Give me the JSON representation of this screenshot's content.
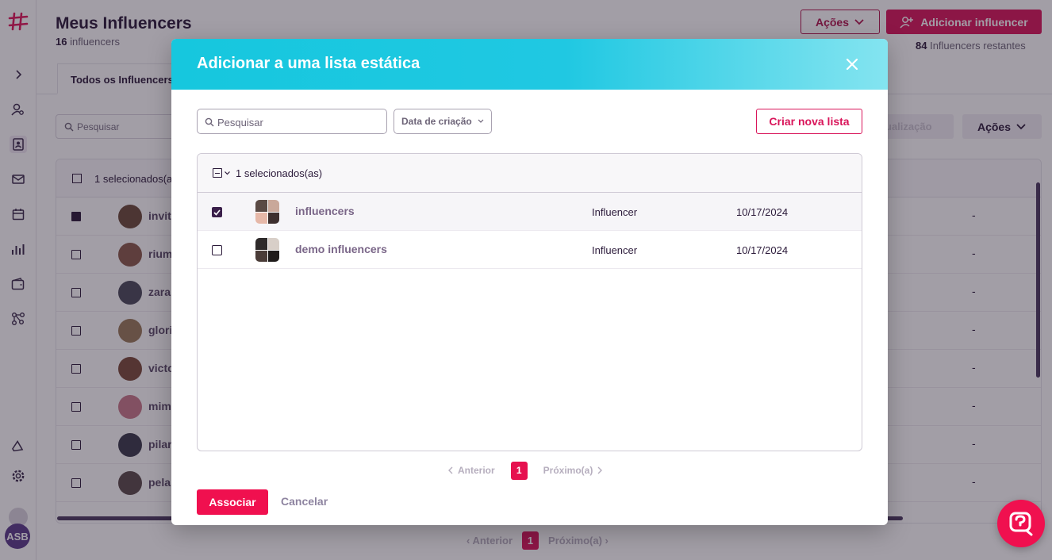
{
  "app": {
    "title": "Meus Influencers",
    "count_number": "16",
    "count_label": " influencers",
    "actions_label": "Ações",
    "add_button_label": "Adicionar influencer",
    "remaining_number": "84",
    "remaining_label": " Influencers restantes",
    "tab_all": "Todos os Influencers",
    "search_placeholder": "Pesquisar",
    "visualization_label": "ualização",
    "actions_secondary": "Ações",
    "selected_label": "1 selecionados(a",
    "avatar_initials": "ASB",
    "rows": [
      {
        "name": "invit",
        "checked": true,
        "value": "-"
      },
      {
        "name": "rium",
        "checked": false,
        "value": "-"
      },
      {
        "name": "zara",
        "checked": false,
        "value": "-"
      },
      {
        "name": "glori",
        "checked": false,
        "value": "-"
      },
      {
        "name": "victo",
        "checked": false,
        "value": "-"
      },
      {
        "name": "mim",
        "checked": false,
        "value": "-"
      },
      {
        "name": "pilar",
        "checked": false,
        "value": "-"
      },
      {
        "name": "pela",
        "checked": false,
        "value": "-"
      }
    ],
    "pager": {
      "prev": "Anterior",
      "current": "1",
      "next": "Próximo(a)"
    }
  },
  "modal": {
    "title": "Adicionar a uma lista estática",
    "search_placeholder": "Pesquisar",
    "date_filter": "Data de criação",
    "create_list_label": "Criar nova lista",
    "selected_text": "1 selecionados(as)",
    "lists": [
      {
        "name": "influencers",
        "type": "Influencer",
        "date": "10/17/2024",
        "checked": true
      },
      {
        "name": "demo influencers",
        "type": "Influencer",
        "date": "10/17/2024",
        "checked": false
      }
    ],
    "pager": {
      "prev": "Anterior",
      "current": "1",
      "next": "Próximo(a)"
    },
    "associate_label": "Associar",
    "cancel_label": "Cancelar"
  },
  "colors": {
    "brand_pink": "#f0104f",
    "header_cyan": "#16c7de",
    "dark_purple": "#2b1a3a"
  },
  "icons": [
    "logo-hash-icon",
    "chevron-right-icon",
    "user-search-icon",
    "contacts-icon",
    "mail-icon",
    "calendar-icon",
    "bar-chart-icon",
    "wallet-icon",
    "network-icon",
    "megaphone-icon",
    "gear-icon",
    "close-icon",
    "search-icon",
    "chevron-down-icon",
    "chat-help-icon"
  ]
}
